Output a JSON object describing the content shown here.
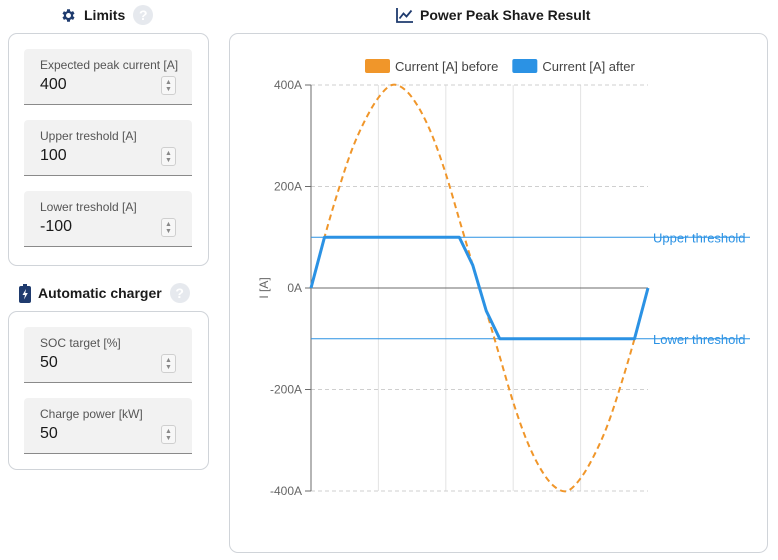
{
  "limits": {
    "title": "Limits",
    "fields": [
      {
        "label": "Expected peak current [A]",
        "value": "400"
      },
      {
        "label": "Upper treshold [A]",
        "value": "100"
      },
      {
        "label": "Lower treshold [A]",
        "value": "-100"
      }
    ]
  },
  "charger": {
    "title": "Automatic charger",
    "fields": [
      {
        "label": "SOC target [%]",
        "value": "50"
      },
      {
        "label": "Charge power [kW]",
        "value": "50"
      }
    ]
  },
  "help_icon": "?",
  "chart": {
    "title": "Power Peak Shave Result"
  },
  "chart_data": {
    "type": "line",
    "ylabel": "I [A]",
    "xlabel": "",
    "ylim": [
      -400,
      400
    ],
    "yticks": [
      400,
      200,
      0,
      -200,
      -400
    ],
    "ytick_labels": [
      "400A",
      "200A",
      "0A",
      "-200A",
      "-400A"
    ],
    "grid": true,
    "legend_position": "top",
    "series": [
      {
        "name": "Current [A] before",
        "color": "#f0962a",
        "style": "dashed",
        "values": [
          0,
          100,
          190,
          270,
          330,
          375,
          400,
          390,
          355,
          300,
          225,
          135,
          45,
          -45,
          -135,
          -225,
          -300,
          -355,
          -390,
          -400,
          -375,
          -330,
          -270,
          -190,
          -100,
          0
        ]
      },
      {
        "name": "Current [A] after",
        "color": "#2b92e4",
        "style": "solid",
        "values": [
          0,
          100,
          100,
          100,
          100,
          100,
          100,
          100,
          100,
          100,
          100,
          100,
          45,
          -45,
          -100,
          -100,
          -100,
          -100,
          -100,
          -100,
          -100,
          -100,
          -100,
          -100,
          -100,
          0
        ]
      }
    ],
    "thresholds": [
      {
        "label": "Upper threshold",
        "value": 100,
        "color": "#2b92e4"
      },
      {
        "label": "Lower threshold",
        "value": -100,
        "color": "#2b92e4"
      }
    ]
  },
  "colors": {
    "accent": "#2b92e4",
    "before": "#f0962a",
    "icon": "#1f3b6e"
  }
}
